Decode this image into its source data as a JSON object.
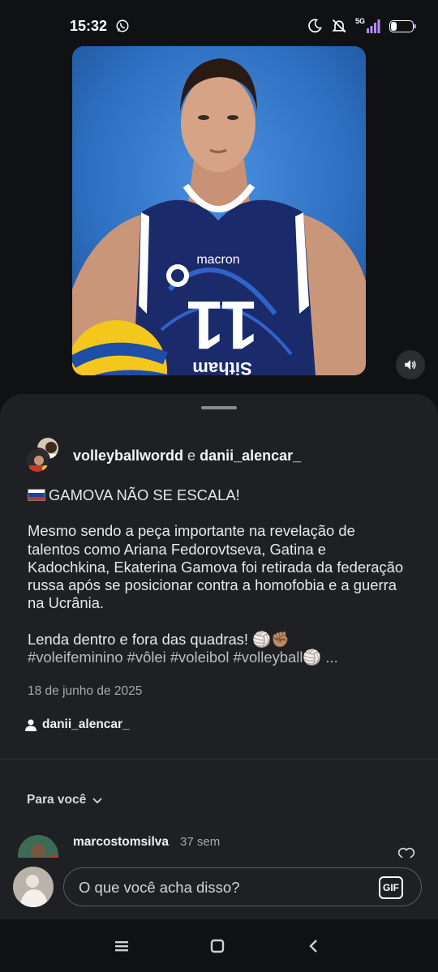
{
  "status_bar": {
    "time": "15:32",
    "network": "5G",
    "battery": "26",
    "icons": [
      "whatsapp-icon",
      "moon-icon",
      "mute-icon",
      "signal-icon",
      "battery-icon"
    ]
  },
  "media": {
    "jersey_brand": "macron",
    "jersey_number": "11",
    "jersey_sponsor": "Sitham",
    "sound_icon": "volume-icon"
  },
  "post": {
    "authors": {
      "primary": "volleyballwordd",
      "conjunction": "e",
      "secondary": "danii_alencar_"
    },
    "caption": {
      "headline": "GAMOVA NÃO SE ESCALA!",
      "body": "Mesmo sendo a peça importante na revelação de talentos como Ariana Fedorovtseva, Gatina e Kadochkina, Ekaterina Gamova foi retirada da federação russa após se posicionar contra a homofobia e a guerra na Ucrânia.",
      "closing": "Lenda dentro e fora das quadras! 🏐✊🏽",
      "hashtags": "#voleifeminino #vôlei #voleibol #volleyball🏐 ..."
    },
    "date": "18 de junho de 2025",
    "tagged_user": "danii_alencar_"
  },
  "comments": {
    "filter_label": "Para você",
    "items": [
      {
        "user": "marcostomsilva",
        "time": "37 sem"
      }
    ]
  },
  "composer": {
    "placeholder": "O que você acha disso?",
    "gif_label": "GIF"
  },
  "colors": {
    "background": "#101113",
    "sheet": "#1f2023",
    "text": "#f2f2f2",
    "muted": "#a7a9ad",
    "photo_backdrop": "#2d6fc0",
    "jersey": "#1b2a6b"
  }
}
